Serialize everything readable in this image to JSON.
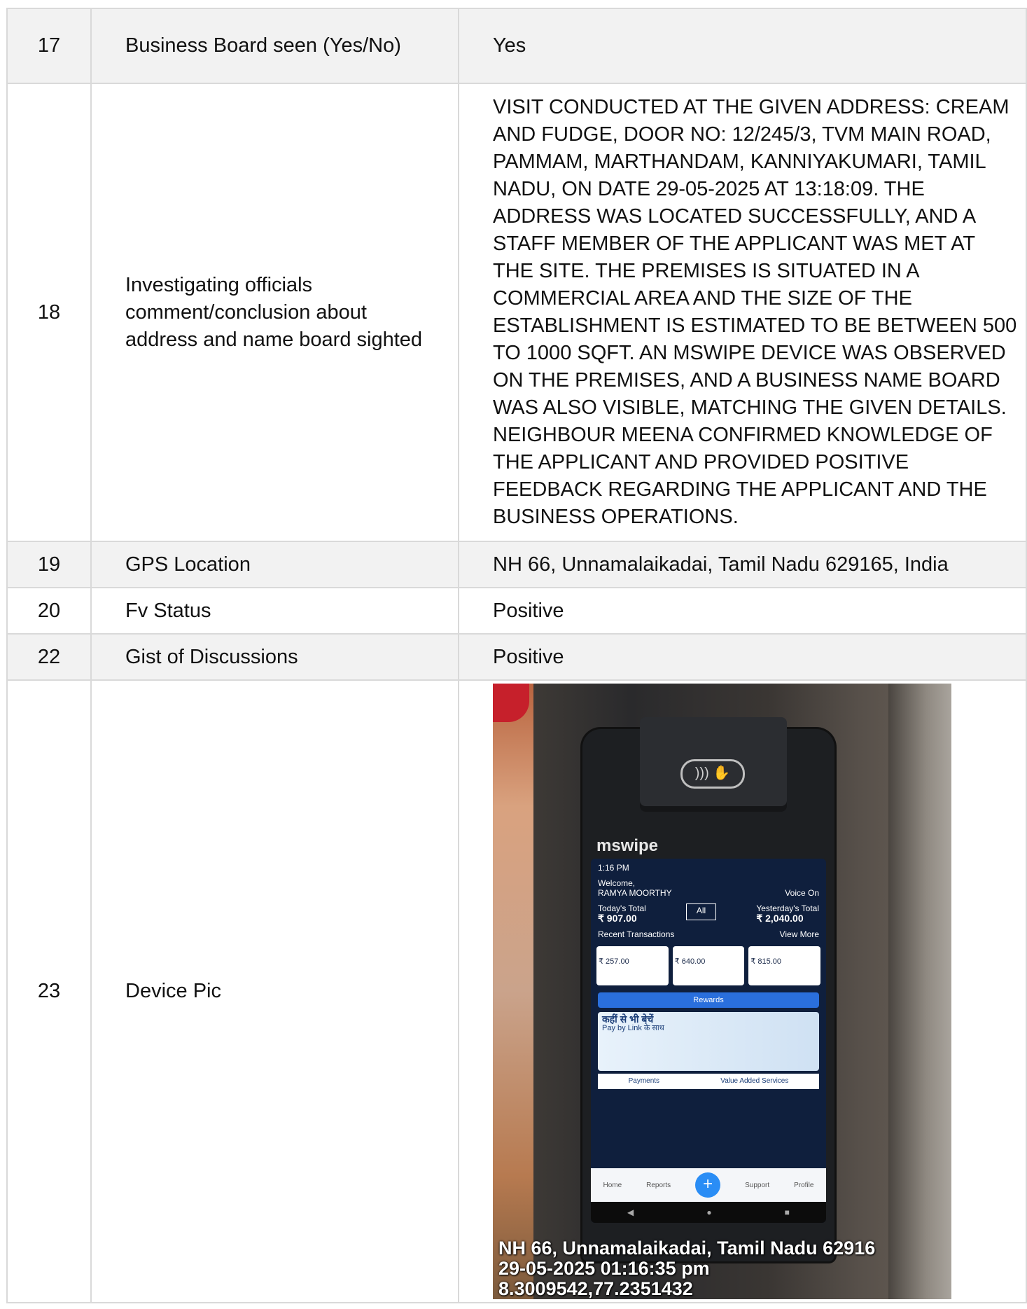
{
  "rows": [
    {
      "no": "17",
      "label": "Business Board seen (Yes/No)",
      "value": "Yes"
    },
    {
      "no": "18",
      "label": "Investigating officials comment/conclusion about address and name board sighted",
      "value": "VISIT CONDUCTED AT THE GIVEN ADDRESS: CREAM AND FUDGE, DOOR NO: 12/245/3, TVM MAIN ROAD, PAMMAM, MARTHANDAM, KANNIYAKUMARI, TAMIL NADU, ON DATE 29-05-2025 AT 13:18:09. THE ADDRESS WAS LOCATED SUCCESSFULLY, AND A STAFF MEMBER OF THE APPLICANT WAS MET AT THE SITE. THE PREMISES IS SITUATED IN A COMMERCIAL AREA AND THE SIZE OF THE ESTABLISHMENT IS ESTIMATED TO BE BETWEEN 500 TO 1000 SQFT. AN MSWIPE DEVICE WAS OBSERVED ON THE PREMISES, AND A BUSINESS NAME BOARD WAS ALSO VISIBLE, MATCHING THE GIVEN DETAILS. NEIGHBOUR MEENA CONFIRMED KNOWLEDGE OF THE APPLICANT AND PROVIDED POSITIVE FEEDBACK REGARDING THE APPLICANT AND THE BUSINESS OPERATIONS."
    },
    {
      "no": "19",
      "label": "GPS Location",
      "value": "NH 66, Unnamalaikadai, Tamil Nadu 629165, India"
    },
    {
      "no": "20",
      "label": "Fv Status",
      "value": "Positive"
    },
    {
      "no": "22",
      "label": "Gist of Discussions",
      "value": "Positive"
    },
    {
      "no": "23",
      "label": "Device Pic"
    }
  ],
  "photo": {
    "brand": "mswipe",
    "screen": {
      "time": "1:16 PM",
      "welcome": "Welcome,",
      "user": "RAMYA  MOORTHY",
      "voice": "Voice On",
      "today_label": "Today's Total",
      "today_amount": "₹ 907.00",
      "filter": "All",
      "yesterday_label": "Yesterday's Total",
      "yesterday_amount": "₹ 2,040.00",
      "recent": "Recent Transactions",
      "view_more": "View More",
      "txn1": "₹ 257.00",
      "txn2": "₹ 640.00",
      "txn3": "₹ 815.00",
      "rewards": "Rewards",
      "banner_hi": "कहीं से भी बेचें",
      "banner_en": "Pay by Link के साथ",
      "tab_payments": "Payments",
      "tab_vas": "Value Added Services",
      "nav_home": "Home",
      "nav_reports": "Reports",
      "nav_support": "Support",
      "nav_profile": "Profile"
    },
    "stamp_line1": "NH 66, Unnamalaikadai, Tamil Nadu 62916",
    "stamp_line2": "29-05-2025 01:16:35 pm",
    "stamp_line3": "8.3009542,77.2351432"
  }
}
